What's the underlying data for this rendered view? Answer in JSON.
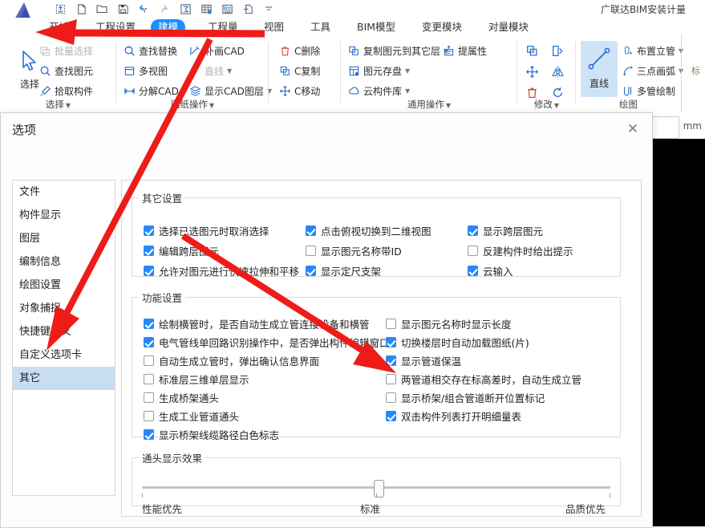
{
  "app": {
    "window_title": "广联达BIM安装计量",
    "logo_letter": "A",
    "quick_access": [
      {
        "name": "save-as-icon",
        "label": "另存为"
      },
      {
        "name": "new-file-icon",
        "label": "新建"
      },
      {
        "name": "open-folder-icon",
        "label": "打开"
      },
      {
        "name": "save-icon",
        "label": "保存"
      },
      {
        "name": "undo-icon",
        "label": "撤销"
      },
      {
        "name": "redo-icon",
        "label": "恢复"
      },
      {
        "name": "sum-icon",
        "label": "汇总计算"
      },
      {
        "name": "table-icon",
        "label": "查看工程量"
      },
      {
        "name": "report-icon",
        "label": "报表"
      },
      {
        "name": "add-view-icon",
        "label": "新建视图"
      },
      {
        "name": "more-icon",
        "label": "更多"
      }
    ],
    "unit_label": "mm",
    "unit_value": ""
  },
  "ribbon": {
    "tabs": [
      {
        "label": "开始",
        "active": false
      },
      {
        "label": "工程设置",
        "active": false
      },
      {
        "label": "建模",
        "active": true
      },
      {
        "label": "工程量",
        "active": false
      },
      {
        "label": "视图",
        "active": false
      },
      {
        "label": "工具",
        "active": false
      },
      {
        "label": "BIM模型",
        "active": false
      },
      {
        "label": "变更模块",
        "active": false
      },
      {
        "label": "对量模块",
        "active": false
      }
    ],
    "groups": [
      {
        "label": "选择",
        "has_caret": true,
        "big": {
          "label": "选择",
          "icon": "cursor-arrow-icon",
          "selected": false
        },
        "items": [
          {
            "label": "批量选择",
            "icon": "batch-select-icon",
            "disabled": true,
            "caret": false
          },
          {
            "label": "查找图元",
            "icon": "find-element-icon",
            "disabled": false,
            "caret": false
          },
          {
            "label": "拾取构件",
            "icon": "pick-component-icon",
            "disabled": false,
            "caret": false
          }
        ]
      },
      {
        "label": "图纸操作",
        "has_caret": true,
        "items": [
          {
            "label": "查找替换",
            "icon": "find-replace-icon",
            "disabled": false,
            "caret": false
          },
          {
            "label": "多视图",
            "icon": "multi-view-icon",
            "disabled": false,
            "caret": false
          },
          {
            "label": "分解CAD",
            "icon": "explode-cad-icon",
            "disabled": false,
            "caret": false
          },
          {
            "label": "补画CAD",
            "icon": "draw-cad-icon",
            "disabled": false,
            "caret": false
          },
          {
            "label": "直线",
            "icon": "line-icon",
            "disabled": true,
            "caret": true
          },
          {
            "label": "显示CAD图层",
            "icon": "cad-layer-icon",
            "disabled": false,
            "caret": true
          }
        ]
      },
      {
        "label": "",
        "has_caret": false,
        "items": [
          {
            "label": "C删除",
            "icon": "delete-icon",
            "disabled": false,
            "caret": false
          },
          {
            "label": "C复制",
            "icon": "copy-icon",
            "disabled": false,
            "caret": false
          },
          {
            "label": "C移动",
            "icon": "move-icon",
            "disabled": false,
            "caret": false
          }
        ]
      },
      {
        "label": "通用操作",
        "has_caret": true,
        "items": [
          {
            "label": "复制图元到其它层",
            "icon": "copy-to-layer-icon",
            "disabled": false,
            "caret": true
          },
          {
            "label": "图元存盘",
            "icon": "save-element-icon",
            "disabled": false,
            "caret": true
          },
          {
            "label": "云构件库",
            "icon": "cloud-library-icon",
            "disabled": false,
            "caret": true
          },
          {
            "label": "提属性",
            "icon": "extract-property-icon",
            "disabled": false,
            "caret": false
          }
        ]
      },
      {
        "label": "修改",
        "has_caret": true,
        "icon_items": [
          {
            "name": "copy-small-icon"
          },
          {
            "name": "extend-icon"
          },
          {
            "name": "move-small-icon"
          },
          {
            "name": "mirror-icon"
          },
          {
            "name": "delete-small-icon"
          },
          {
            "name": "rotate-icon"
          }
        ]
      },
      {
        "label": "绘图",
        "has_caret": false,
        "big": {
          "label": "直线",
          "icon": "line-draw-icon",
          "selected": true
        },
        "items": [
          {
            "label": "布置立管",
            "icon": "riser-icon",
            "disabled": false,
            "caret": true
          },
          {
            "label": "三点画弧",
            "icon": "three-point-arc-icon",
            "disabled": false,
            "caret": true
          },
          {
            "label": "多管绘制",
            "icon": "multi-pipe-icon",
            "disabled": false,
            "caret": false
          }
        ]
      }
    ]
  },
  "dialog": {
    "title": "选项",
    "close_label": "✕",
    "nav_items": [
      {
        "label": "文件",
        "selected": false
      },
      {
        "label": "构件显示",
        "selected": false
      },
      {
        "label": "图层",
        "selected": false
      },
      {
        "label": "编制信息",
        "selected": false
      },
      {
        "label": "绘图设置",
        "selected": false
      },
      {
        "label": "对象捕捉",
        "selected": false
      },
      {
        "label": "快捷键定义",
        "selected": false
      },
      {
        "label": "自定义选项卡",
        "selected": false
      },
      {
        "label": "其它",
        "selected": true
      }
    ],
    "group_other": {
      "legend": "其它设置",
      "columns": [
        [
          {
            "label": "选择已选图元时取消选择",
            "checked": true
          },
          {
            "label": "编辑跨层图元",
            "checked": true
          },
          {
            "label": "允许对图元进行快速拉伸和平移",
            "checked": true
          }
        ],
        [
          {
            "label": "点击俯视切换到二维视图",
            "checked": true
          },
          {
            "label": "显示图元名称带ID",
            "checked": false
          },
          {
            "label": "显示定尺支架",
            "checked": true
          }
        ],
        [
          {
            "label": "显示跨层图元",
            "checked": true
          },
          {
            "label": "反建构件时给出提示",
            "checked": false
          },
          {
            "label": "云输入",
            "checked": true
          }
        ]
      ]
    },
    "group_function": {
      "legend": "功能设置",
      "columns": [
        [
          {
            "label": "绘制横管时，是否自动生成立管连接设备和横管",
            "checked": true
          },
          {
            "label": "电气管线单回路识别操作中，是否弹出构件编辑窗口",
            "checked": true
          },
          {
            "label": "自动生成立管时，弹出确认信息界面",
            "checked": false
          },
          {
            "label": "标准层三维单层显示",
            "checked": false
          },
          {
            "label": "生成桥架通头",
            "checked": false
          },
          {
            "label": "生成工业管道通头",
            "checked": false
          },
          {
            "label": "显示桥架线缆路径白色标志",
            "checked": true
          }
        ],
        [
          {
            "label": "显示图元名称时显示长度",
            "checked": false
          },
          {
            "label": "切换楼层时自动加载图纸(片)",
            "checked": true
          },
          {
            "label": "显示管道保温",
            "checked": true
          },
          {
            "label": "两管道相交存在标高差时，自动生成立管",
            "checked": false
          },
          {
            "label": "显示桥架/组合管道断开位置标记",
            "checked": false
          },
          {
            "label": "双击构件列表打开明细量表",
            "checked": true
          }
        ]
      ]
    },
    "group_elbow": {
      "legend": "通头显示效果",
      "slider": {
        "value": 50,
        "min": 0,
        "max": 100,
        "tick_labels": [
          "性能优先",
          "标准",
          "品质优先"
        ]
      }
    }
  },
  "colors": {
    "accent": "#1890ff",
    "checkbox_on": "#2789f3",
    "nav_selected": "#c9ddf2",
    "annotation_arrow": "#ee1c18",
    "ribbon_selected": "#cfe3f7"
  }
}
